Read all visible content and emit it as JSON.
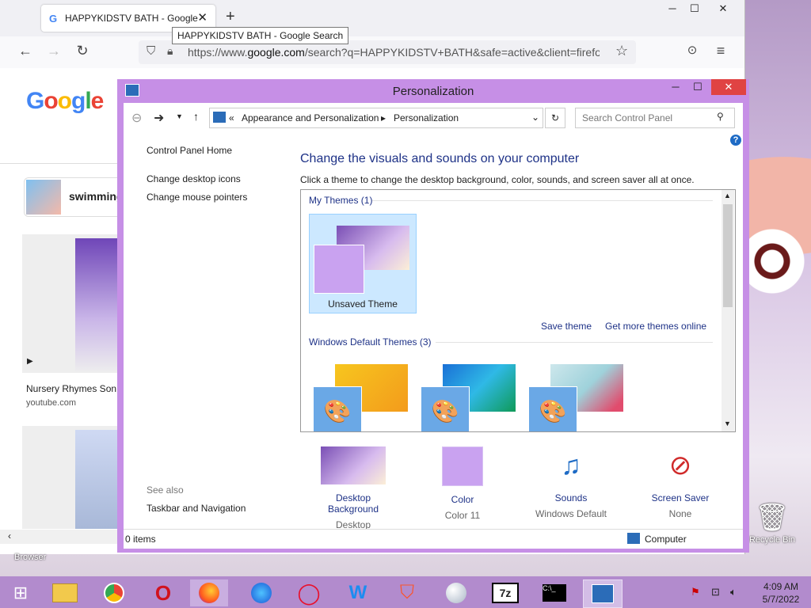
{
  "browser": {
    "tab_title": "HAPPYKIDSTV BATH - Google",
    "tooltip": "HAPPYKIDSTV BATH - Google Search",
    "url_prefix": "https://www.",
    "url_domain": "google.com",
    "url_rest": "/search?q=HAPPYKIDSTV+BATH&safe=active&client=firefox-b",
    "google_logo": "Google",
    "suggestion": "swimming",
    "result_caption": "Nursery Rhymes Son",
    "result_source": "youtube.com",
    "left_icon_label": "Browser",
    "new_tab": "+",
    "close": "✕",
    "minimize": "─",
    "maximize": "☐"
  },
  "cp": {
    "title": "Personalization",
    "breadcrumb_sep": "«",
    "breadcrumb_1": "Appearance and Personalization",
    "breadcrumb_2": "Personalization",
    "search_placeholder": "Search Control Panel",
    "left_home": "Control Panel Home",
    "left_icons": "Change desktop icons",
    "left_mouse": "Change mouse pointers",
    "see_also": "See also",
    "taskbar_nav": "Taskbar and Navigation",
    "heading": "Change the visuals and sounds on your computer",
    "subheading": "Click a theme to change the desktop background, color, sounds, and screen saver all at once.",
    "my_themes": "My Themes (1)",
    "unsaved_theme": "Unsaved Theme",
    "save_theme": "Save theme",
    "get_more": "Get more themes online",
    "default_themes": "Windows Default Themes (3)",
    "bottom": [
      {
        "link": "Desktop Background",
        "value": "Desktop Background"
      },
      {
        "link": "Color",
        "value": "Color 11"
      },
      {
        "link": "Sounds",
        "value": "Windows Default"
      },
      {
        "link": "Screen Saver",
        "value": "None"
      }
    ],
    "status_items": "0 items",
    "status_computer": "Computer"
  },
  "desktop": {
    "recycle_bin": "Recycle Bin"
  },
  "taskbar": {
    "time": "4:09 AM",
    "date": "5/7/2022",
    "sevenzip": "7z"
  },
  "colors": {
    "accent": "#c68fe6",
    "link": "#1e3287",
    "taskbar": "#b28bcd"
  }
}
